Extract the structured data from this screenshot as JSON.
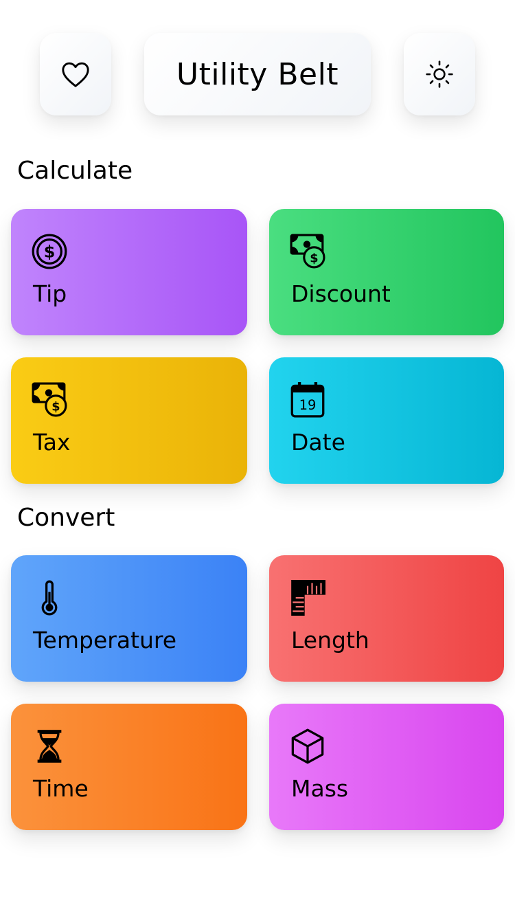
{
  "header": {
    "title": "Utility Belt",
    "favorite_icon": "heart-icon",
    "theme_icon": "sun-icon"
  },
  "sections": [
    {
      "title": "Calculate",
      "tiles": [
        {
          "label": "Tip",
          "icon": "dollar-coin-icon",
          "color": "#a855f7"
        },
        {
          "label": "Discount",
          "icon": "cash-coin-icon",
          "color": "#22c55e"
        },
        {
          "label": "Tax",
          "icon": "cash-coin-icon",
          "color": "#eab308"
        },
        {
          "label": "Date",
          "icon": "calendar-icon",
          "color": "#06b6d4",
          "icon_text": "19"
        }
      ]
    },
    {
      "title": "Convert",
      "tiles": [
        {
          "label": "Temperature",
          "icon": "thermometer-icon",
          "color": "#3b82f6"
        },
        {
          "label": "Length",
          "icon": "ruler-icon",
          "color": "#ef4444"
        },
        {
          "label": "Time",
          "icon": "hourglass-icon",
          "color": "#f97316"
        },
        {
          "label": "Mass",
          "icon": "cube-icon",
          "color": "#d946ef"
        }
      ]
    }
  ]
}
